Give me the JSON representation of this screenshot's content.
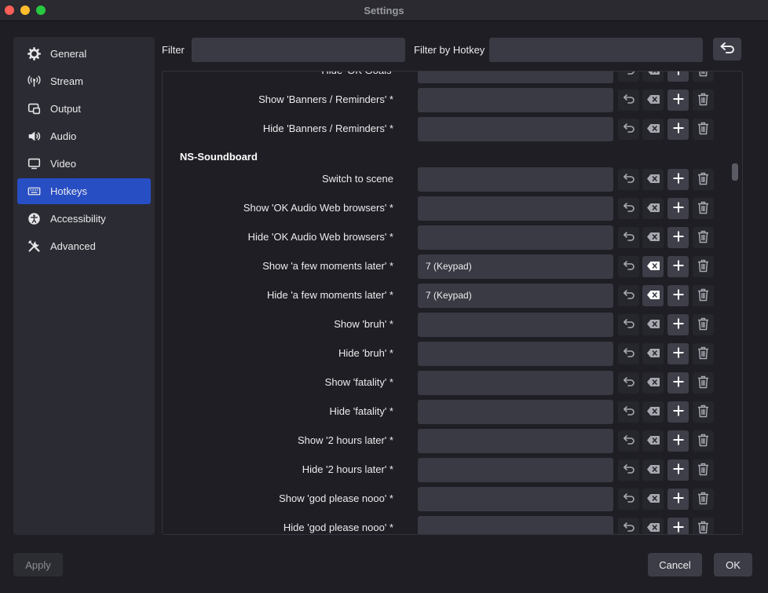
{
  "window": {
    "title": "Settings"
  },
  "sidebar": {
    "items": [
      {
        "label": "General",
        "icon": "gear-icon",
        "active": false
      },
      {
        "label": "Stream",
        "icon": "antenna-icon",
        "active": false
      },
      {
        "label": "Output",
        "icon": "output-icon",
        "active": false
      },
      {
        "label": "Audio",
        "icon": "speaker-icon",
        "active": false
      },
      {
        "label": "Video",
        "icon": "monitor-icon",
        "active": false
      },
      {
        "label": "Hotkeys",
        "icon": "keyboard-icon",
        "active": true
      },
      {
        "label": "Accessibility",
        "icon": "accessibility-icon",
        "active": false
      },
      {
        "label": "Advanced",
        "icon": "tools-icon",
        "active": false
      }
    ]
  },
  "filters": {
    "filter_label": "Filter",
    "filter_value": "",
    "hotkey_label": "Filter by Hotkey",
    "hotkey_value": "",
    "back_icon": "return-icon"
  },
  "hotkeys": {
    "rows_top": [
      {
        "label": "Hide 'OK Goals'",
        "value": ""
      },
      {
        "label": "Show 'Banners / Reminders' *",
        "value": ""
      },
      {
        "label": "Hide 'Banners / Reminders' *",
        "value": ""
      }
    ],
    "section_title": "NS-Soundboard",
    "rows": [
      {
        "label": "Switch to scene",
        "value": ""
      },
      {
        "label": "Show 'OK Audio Web browsers' *",
        "value": ""
      },
      {
        "label": "Hide 'OK Audio Web browsers' *",
        "value": ""
      },
      {
        "label": "Show 'a few moments later' *",
        "value": "7 (Keypad)"
      },
      {
        "label": "Hide 'a few moments later' *",
        "value": "7 (Keypad)"
      },
      {
        "label": "Show 'bruh' *",
        "value": ""
      },
      {
        "label": "Hide 'bruh' *",
        "value": ""
      },
      {
        "label": "Show 'fatality' *",
        "value": ""
      },
      {
        "label": "Hide 'fatality' *",
        "value": ""
      },
      {
        "label": "Show '2 hours later' *",
        "value": ""
      },
      {
        "label": "Hide '2 hours later' *",
        "value": ""
      },
      {
        "label": "Show 'god please nooo' *",
        "value": ""
      },
      {
        "label": "Hide 'god please nooo' *",
        "value": ""
      }
    ],
    "row_icons": {
      "revert": "revert-icon",
      "clear": "clear-icon",
      "add": "add-icon",
      "delete": "trash-icon"
    }
  },
  "footer": {
    "apply_label": "Apply",
    "cancel_label": "Cancel",
    "ok_label": "OK"
  }
}
